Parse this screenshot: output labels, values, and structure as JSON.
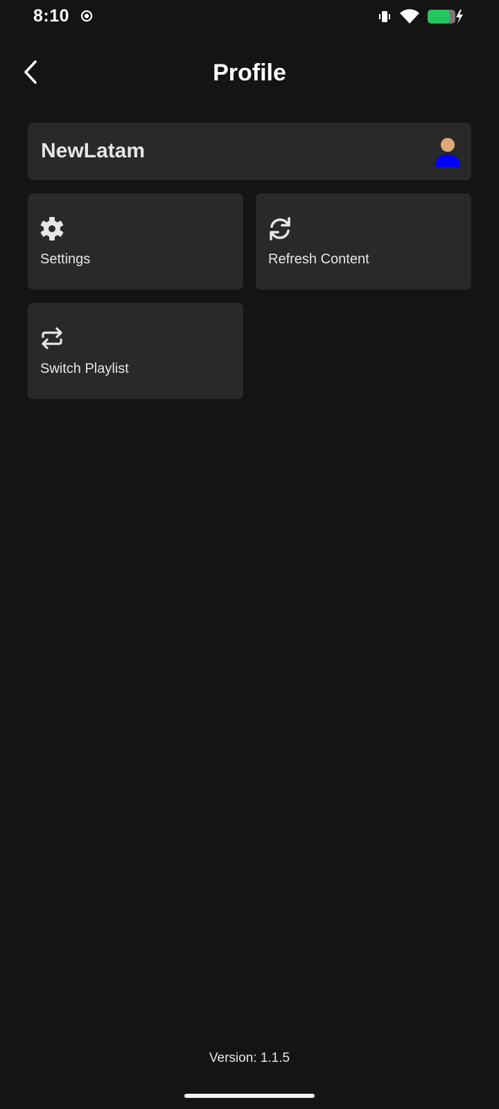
{
  "status_bar": {
    "time": "8:10",
    "icons": [
      "record-icon",
      "vibrate-icon",
      "wifi-icon",
      "battery-charging-icon"
    ],
    "battery_color": "#22c55e"
  },
  "header": {
    "title": "Profile",
    "back_icon": "chevron-left-icon"
  },
  "profile": {
    "name": "NewLatam",
    "avatar_icon": "user-avatar-icon",
    "avatar_colors": {
      "head": "#e0a878",
      "body": "#0000ff"
    }
  },
  "tiles": [
    {
      "label": "Settings",
      "icon": "gear-icon"
    },
    {
      "label": "Refresh Content",
      "icon": "refresh-icon"
    },
    {
      "label": "Switch Playlist",
      "icon": "swap-arrows-icon"
    }
  ],
  "footer": {
    "version": "Version: 1.1.5"
  },
  "colors": {
    "background": "#141414",
    "card": "#292929",
    "text": "#e6e6e6"
  }
}
